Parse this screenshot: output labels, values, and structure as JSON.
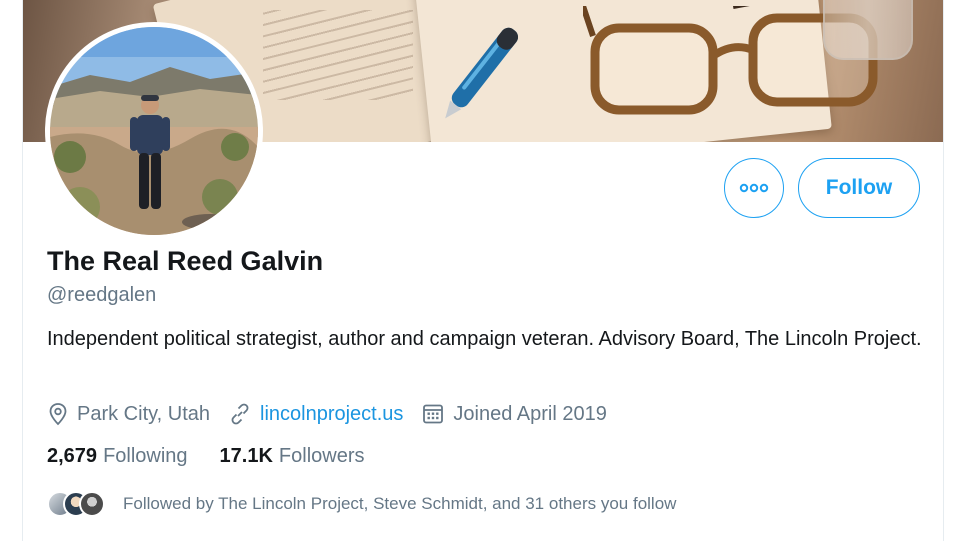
{
  "profile": {
    "display_name": "The Real Reed Galvin",
    "handle": "@reedgalen",
    "bio": "Independent political strategist, author and campaign veteran. Advisory Board, The Lincoln Project.",
    "location": "Park City, Utah",
    "website": "lincolnproject.us",
    "joined": "Joined April 2019"
  },
  "actions": {
    "follow_label": "Follow",
    "more_icon": "more-options-icon"
  },
  "stats": {
    "following_count": "2,679",
    "following_label": "Following",
    "followers_count": "17.1K",
    "followers_label": "Followers"
  },
  "followed_by": {
    "text": "Followed by The Lincoln Project, Steve Schmidt, and 31 others you follow"
  },
  "icons": {
    "location": "location-pin-icon",
    "link": "link-icon",
    "calendar": "calendar-icon"
  },
  "colors": {
    "accent": "#1da1f2",
    "link": "#1b95e0",
    "secondary_text": "#657786",
    "primary_text": "#14171a"
  }
}
